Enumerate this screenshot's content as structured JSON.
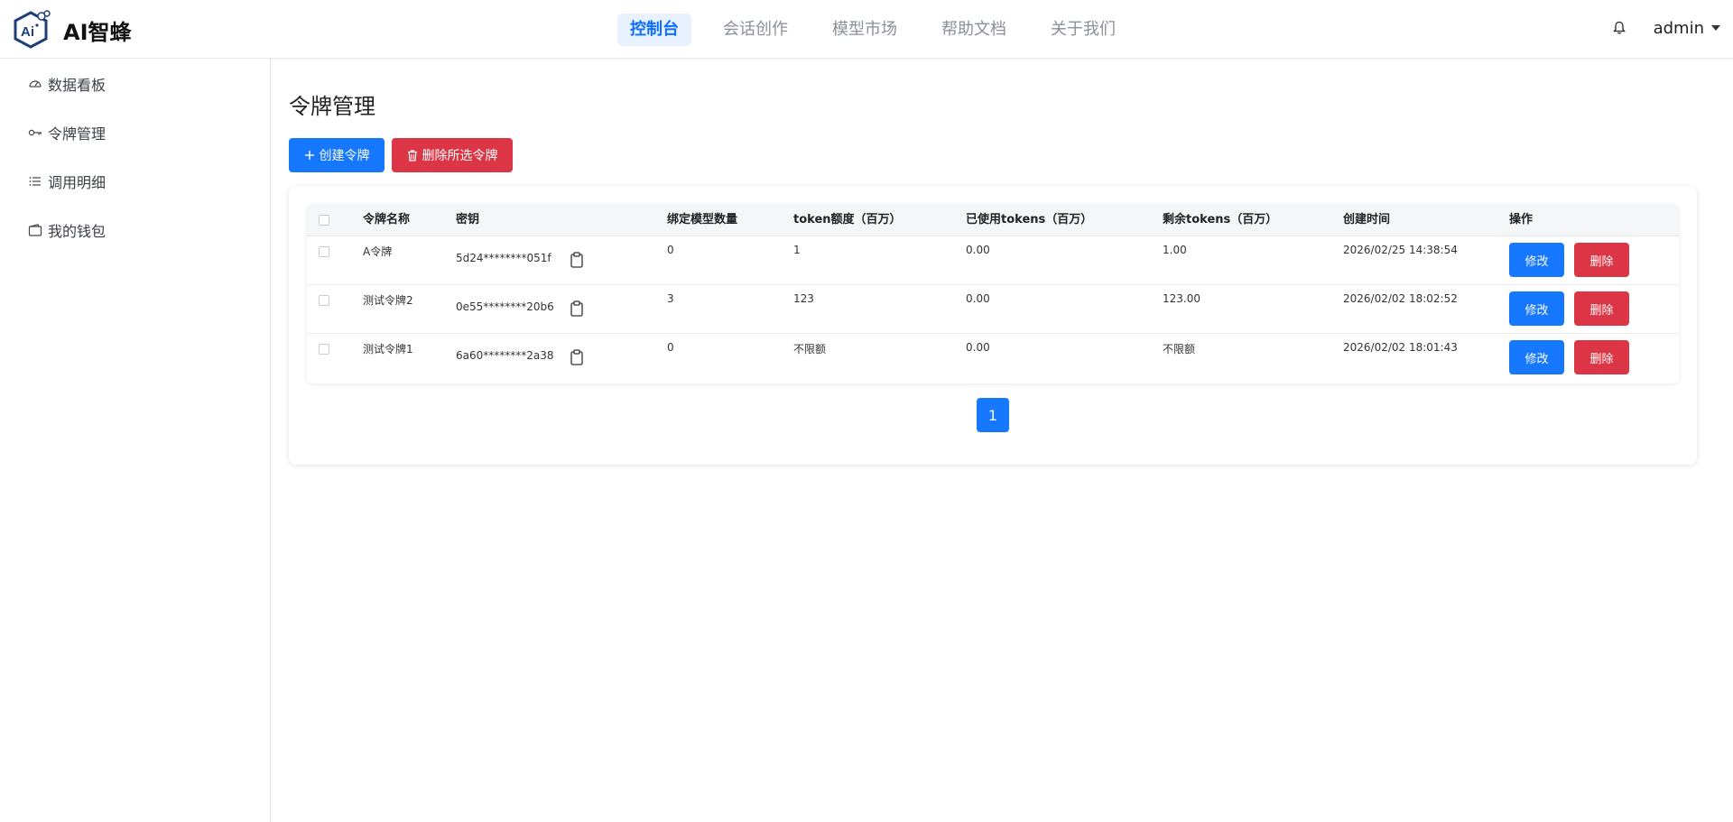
{
  "brand": {
    "name": "AI智蜂",
    "logo_text": "Ai"
  },
  "nav": [
    {
      "label": "控制台",
      "active": true
    },
    {
      "label": "会话创作",
      "active": false
    },
    {
      "label": "模型市场",
      "active": false
    },
    {
      "label": "帮助文档",
      "active": false
    },
    {
      "label": "关于我们",
      "active": false
    }
  ],
  "header": {
    "notification_icon": "bell-icon",
    "username": "admin"
  },
  "sidebar": {
    "items": [
      {
        "label": "数据看板",
        "icon": "gauge-icon"
      },
      {
        "label": "令牌管理",
        "icon": "key-icon"
      },
      {
        "label": "调用明细",
        "icon": "list-icon"
      },
      {
        "label": "我的钱包",
        "icon": "wallet-icon"
      }
    ]
  },
  "main": {
    "title": "令牌管理",
    "create_button": "创建令牌",
    "delete_selected_button": "删除所选令牌"
  },
  "table": {
    "columns": [
      "令牌名称",
      "密钥",
      "绑定模型数量",
      "token额度（百万）",
      "已使用tokens（百万）",
      "剩余tokens（百万）",
      "创建时间",
      "操作"
    ],
    "rows": [
      {
        "name": "A令牌",
        "key": "5d24********051f",
        "models": "0",
        "quota": "1",
        "used": "0.00",
        "remaining": "1.00",
        "created": "2026/02/25 14:38:54"
      },
      {
        "name": "测试令牌2",
        "key": "0e55********20b6",
        "models": "3",
        "quota": "123",
        "used": "0.00",
        "remaining": "123.00",
        "created": "2026/02/02 18:02:52"
      },
      {
        "name": "测试令牌1",
        "key": "6a60********2a38",
        "models": "0",
        "quota": "不限额",
        "used": "0.00",
        "remaining": "不限额",
        "created": "2026/02/02 18:01:43"
      }
    ],
    "edit_label": "修改",
    "delete_label": "删除"
  },
  "pagination": {
    "current": "1"
  },
  "colors": {
    "primary": "#1677ff",
    "danger": "#dc3545",
    "nav_active_bg": "#e7f1ff",
    "nav_active_text": "#0d6efd"
  }
}
